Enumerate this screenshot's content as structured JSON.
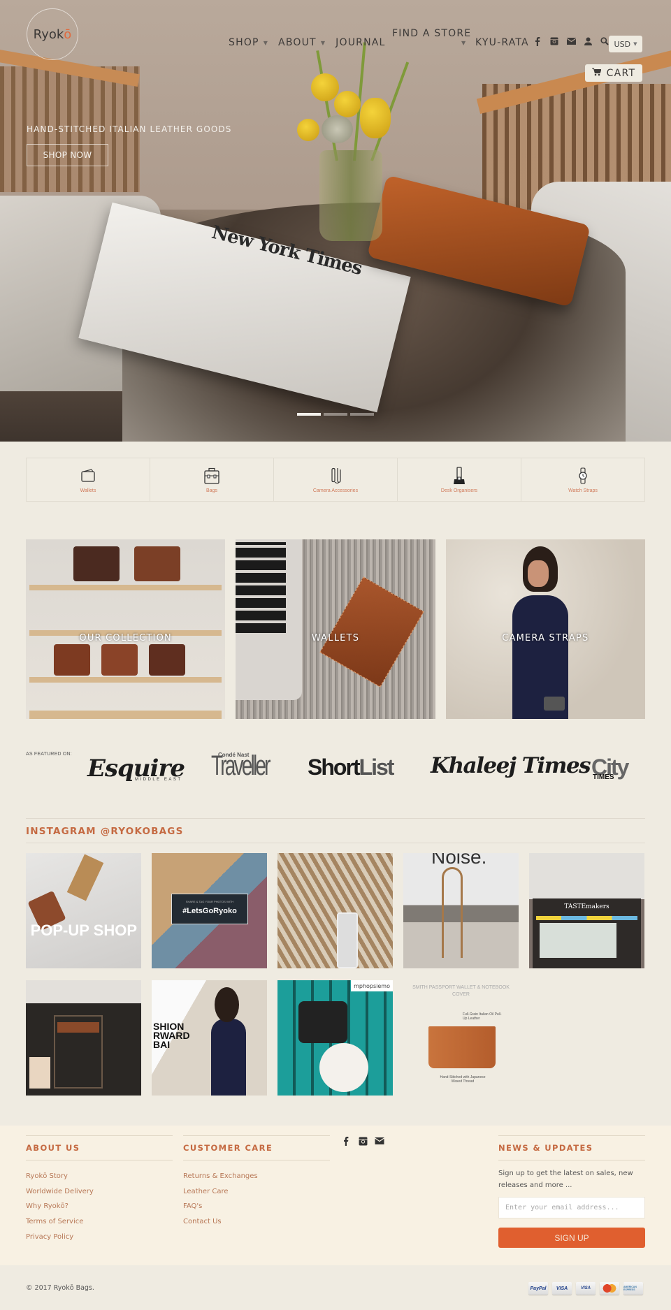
{
  "brand": {
    "name_main": "Ryok",
    "name_accent": "ō",
    "accent_color": "#e06a3e"
  },
  "nav": {
    "items": [
      {
        "label": "SHOP",
        "has_dropdown": true
      },
      {
        "label": "ABOUT",
        "has_dropdown": true
      },
      {
        "label": "JOURNAL",
        "has_dropdown": false
      }
    ],
    "find_store": "FIND A STORE",
    "kyu_rata": "KYU-RATA",
    "icons": [
      "facebook-icon",
      "instagram-icon",
      "mail-icon",
      "account-icon",
      "search-icon"
    ],
    "currency": "USD",
    "cart_label": "CART"
  },
  "hero": {
    "tagline": "HAND-STITCHED ITALIAN LEATHER GOODS",
    "cta": "SHOP NOW",
    "slides": 3,
    "active_slide": 1,
    "newspaper_masthead": "New York Times"
  },
  "categories": [
    {
      "label": "Wallets",
      "icon": "wallet-icon"
    },
    {
      "label": "Bags",
      "icon": "briefcase-icon"
    },
    {
      "label": "Camera Accessories",
      "icon": "camera-strap-icon"
    },
    {
      "label": "Desk Organisers",
      "icon": "phone-dock-icon"
    },
    {
      "label": "Watch Straps",
      "icon": "watch-icon"
    }
  ],
  "collections": [
    {
      "label": "OUR COLLECTION"
    },
    {
      "label": "WALLETS"
    },
    {
      "label": "CAMERA STRAPS"
    }
  ],
  "featured": {
    "label": "AS FEATURED ON:",
    "esquire": "Esquire",
    "esquire_sub": "MIDDLE EAST",
    "conde_nast": "Condé Nast",
    "traveller": "Traveller",
    "shortlist_a": "Short",
    "shortlist_b": "List",
    "khaleej": "Khaleej Times",
    "city": "City",
    "city_times": "TIMES"
  },
  "instagram": {
    "title": "INSTAGRAM @RYOKOBAGS",
    "posts": [
      {
        "caption": "POP-UP SHOP"
      },
      {
        "caption_small": "SHARE & TAG YOUR PHOTOS WITH",
        "caption": "#LetsGoRyoko"
      },
      {
        "caption": ""
      },
      {
        "caption": "Noise."
      },
      {
        "caption": "TASTEmakers"
      },
      {
        "caption": ""
      },
      {
        "caption": "SHION RWARD BAI"
      },
      {
        "caption": "mphopsiemo"
      },
      {
        "caption": "SMITH PASSPORT WALLET & NOTEBOOK COVER",
        "note_1": "Full-Grain Italian Oil Pull-Up Leather",
        "note_2": "Hand-Stitched with Japanese Waxed Thread"
      }
    ]
  },
  "footer": {
    "about": {
      "title": "ABOUT US",
      "links": [
        "Ryokō Story",
        "Worldwide Delivery",
        "Why Ryokō?",
        "Terms of Service",
        "Privacy Policy"
      ]
    },
    "care": {
      "title": "CUSTOMER CARE",
      "links": [
        "Returns & Exchanges",
        "Leather Care",
        "FAQ's",
        "Contact Us"
      ]
    },
    "social_icons": [
      "facebook-icon",
      "instagram-icon",
      "mail-icon"
    ],
    "news": {
      "title": "NEWS & UPDATES",
      "text": "Sign up to get the latest on sales, new releases and more ...",
      "placeholder": "Enter your email address...",
      "button": "SIGN UP"
    },
    "copyright": "© 2017 Ryokō Bags.",
    "payments": [
      "PayPal",
      "VISA",
      "VISA Electron",
      "MasterCard",
      "American Express"
    ]
  },
  "colors": {
    "accent": "#c56a42",
    "button": "#e05f2f",
    "page_bg": "#efebe1",
    "footer_bg": "#f8f1e3"
  }
}
